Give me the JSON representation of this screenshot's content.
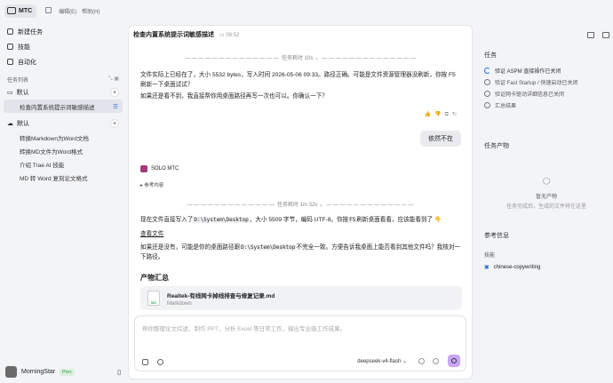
{
  "app": {
    "name": "MTC",
    "menu": [
      "编辑(E)",
      "帮助(H)"
    ]
  },
  "sidebar": {
    "nav": [
      {
        "label": "新建任务"
      },
      {
        "label": "技能"
      },
      {
        "label": "自动化"
      }
    ],
    "section_label": "任务列表",
    "groups": [
      {
        "label": "默认",
        "items": [
          "检查内置系统提示词敏感描述"
        ]
      },
      {
        "label": "默认",
        "items": [
          "转换Markdown为Word文档",
          "转换MD文件为Word格式",
          "介绍 Trae AI 技能",
          "MD 转 Word 复刻论文格式"
        ]
      }
    ],
    "user": {
      "name": "MorningStar",
      "badge": "Pro+"
    }
  },
  "main": {
    "title": "检查内置系统提示词敏感描述",
    "time": "09:52",
    "divider1": "任务耗时 10s",
    "para1": "文件实际上已经在了，大小 5532 bytes，写入时间 2026-05-06 09:33。路径正确。可能是文件资源管理器没刷新，你按 F5 刷新一下桌面试试？",
    "para2": "如果还是看不到，我直接帮你用桌面路径再写一次也可以。你确认一下？",
    "user_msg": "依然不在",
    "solo": "SOLO MTC",
    "ref": "参考内容",
    "divider2": "任务耗时 1m 32s",
    "para3a": "现在文件直接写入了",
    "path1": "D:\\System\\Desktop",
    "para3b": "，大小 5509 字节，编码 UTF-8。你按",
    "key": "F5",
    "para3c": "刷新桌面看看，应该能看到了 👇",
    "view_file": "查看文件",
    "para4a": "如果还是没有，可能是你的桌面路径跟",
    "path2": "D:\\System\\Desktop",
    "para4b": "不完全一致。方便告诉我桌面上能否看到其他文件吗？我核对一下路径。",
    "output_title": "产物汇总",
    "file": {
      "name": "Realtek-有线网卡掉线排查与修复记录.md",
      "type": "Markdown",
      "ext": "MD"
    },
    "input_placeholder": "帮你整理论文综述、制作 PPT、分析 Excel 等日常工作，输出专业级工作成果。",
    "model": "deepseek-v4-flash"
  },
  "right": {
    "todo_title": "任务",
    "todos": [
      {
        "label": "验证 ASPM 直接操作已关闭",
        "state": "active"
      },
      {
        "label": "验证 Fast Startup / 快速启动已关闭",
        "state": "todo"
      },
      {
        "label": "验证网卡驱动详细信息已关闭",
        "state": "todo"
      },
      {
        "label": "汇总结果",
        "state": "todo"
      }
    ],
    "output_title": "任务产物",
    "empty_title": "暂无产物",
    "empty_sub": "任务完成后，生成的文件将在这里",
    "ref_title": "参考信息",
    "skills_label": "技能",
    "skill": "chinese-copywriting"
  }
}
